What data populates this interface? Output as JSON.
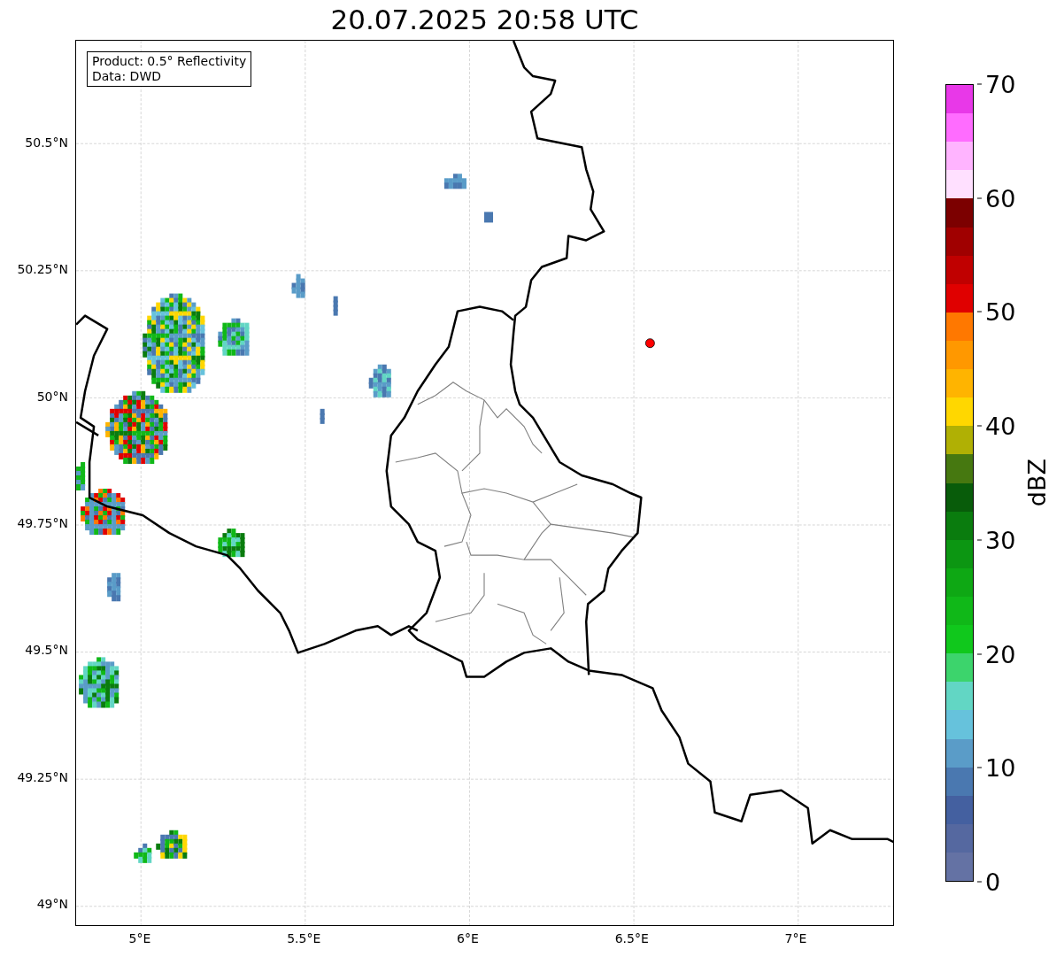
{
  "title": "20.07.2025 20:58 UTC",
  "info_box": {
    "lines": [
      "Product: 0.5° Reflectivity",
      "Data: DWD"
    ]
  },
  "y_ticks": [
    "50.5°N",
    "50.25°N",
    "50°N",
    "49.75°N",
    "49.5°N",
    "49.25°N",
    "49°N"
  ],
  "x_ticks": [
    "5°E",
    "5.5°E",
    "6°E",
    "6.5°E",
    "7°E"
  ],
  "colorbar": {
    "label": "dBZ",
    "ticks": [
      "70",
      "60",
      "50",
      "40",
      "30",
      "20",
      "10",
      "0"
    ],
    "bands": [
      {
        "color": "#e838e8"
      },
      {
        "color": "#ff6cff"
      },
      {
        "color": "#ffb4ff"
      },
      {
        "color": "#ffe0ff"
      },
      {
        "color": "#7c0000"
      },
      {
        "color": "#a00000"
      },
      {
        "color": "#c00000"
      },
      {
        "color": "#e00000"
      },
      {
        "color": "#ff7800"
      },
      {
        "color": "#ff9800"
      },
      {
        "color": "#ffb400"
      },
      {
        "color": "#ffd700"
      },
      {
        "color": "#b0b004"
      },
      {
        "color": "#467810"
      },
      {
        "color": "#085c0a"
      },
      {
        "color": "#0a7c0e"
      },
      {
        "color": "#0c9612"
      },
      {
        "color": "#0ea814"
      },
      {
        "color": "#10b818"
      },
      {
        "color": "#10c81c"
      },
      {
        "color": "#3cd46c"
      },
      {
        "color": "#62d6c4"
      },
      {
        "color": "#66c2dc"
      },
      {
        "color": "#5a9cc8"
      },
      {
        "color": "#4a78b0"
      },
      {
        "color": "#4460a0"
      },
      {
        "color": "#5568a0"
      },
      {
        "color": "#6472a4"
      }
    ]
  }
}
